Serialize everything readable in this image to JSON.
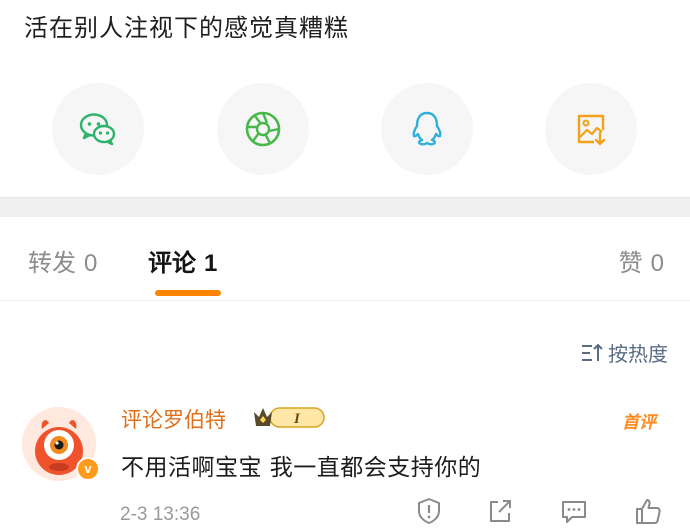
{
  "post": {
    "text": "活在别人注视下的感觉真糟糕"
  },
  "share": {
    "icons": [
      "wechat-icon",
      "moments-icon",
      "qq-icon",
      "save-image-icon"
    ],
    "colors": {
      "wechat": "#2fb36b",
      "moments": "#47b84a",
      "qq": "#2eb0d9",
      "save": "#f2a11b"
    }
  },
  "tabs": {
    "repost": {
      "label": "转发",
      "count": "0"
    },
    "comment": {
      "label": "评论",
      "count": "1"
    },
    "like": {
      "label": "赞",
      "count": "0"
    },
    "active": "comment",
    "accent": "#ff8200"
  },
  "sort": {
    "label": "按热度",
    "icon": "sort-icon"
  },
  "comment": {
    "username": "评论罗伯特",
    "vip_level": "I",
    "tag": "首评",
    "text": "不用活啊宝宝 我一直都会支持你的",
    "time": "2-3 13:36",
    "avatar_badge": "v",
    "actions": [
      "report-icon",
      "share-icon",
      "reply-icon",
      "like-icon"
    ]
  }
}
